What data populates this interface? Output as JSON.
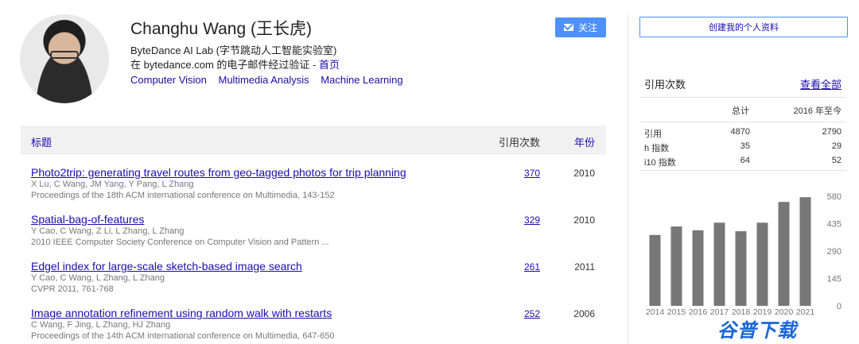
{
  "profile": {
    "name": "Changhu Wang (王长虎)",
    "affiliation": "ByteDance AI Lab (字节跳动人工智能实验室)",
    "email_prefix": "在 bytedance.com 的电子邮件经过验证 - ",
    "email_home": "首页",
    "interests": [
      "Computer Vision",
      "Multimedia Analysis",
      "Machine Learning"
    ]
  },
  "buttons": {
    "follow": "关注",
    "create_profile": "创建我的个人资料"
  },
  "table": {
    "header_title": "标题",
    "header_cites": "引用次数",
    "header_year": "年份",
    "rows": [
      {
        "title": "Photo2trip: generating travel routes from geo-tagged photos for trip planning",
        "authors": "X Lu, C Wang, JM Yang, Y Pang, L Zhang",
        "venue": "Proceedings of the 18th ACM international conference on Multimedia, 143-152",
        "cites": "370",
        "year": "2010"
      },
      {
        "title": "Spatial-bag-of-features",
        "authors": "Y Cao, C Wang, Z Li, L Zhang, L Zhang",
        "venue": "2010 IEEE Computer Society Conference on Computer Vision and Pattern ...",
        "cites": "329",
        "year": "2010"
      },
      {
        "title": "Edgel index for large-scale sketch-based image search",
        "authors": "Y Cao, C Wang, L Zhang, L Zhang",
        "venue": "CVPR 2011, 761-768",
        "cites": "261",
        "year": "2011"
      },
      {
        "title": "Image annotation refinement using random walk with restarts",
        "authors": "C Wang, F Jing, L Zhang, HJ Zhang",
        "venue": "Proceedings of the 14th ACM international conference on Multimedia, 647-650",
        "cites": "252",
        "year": "2006"
      }
    ]
  },
  "citations": {
    "heading": "引用次数",
    "view_all": "查看全部",
    "col_total": "总计",
    "col_since": "2016 年至今",
    "stats": [
      {
        "label": "引用",
        "total": "4870",
        "since": "2790"
      },
      {
        "label": "h 指数",
        "total": "35",
        "since": "29"
      },
      {
        "label": "i10 指数",
        "total": "64",
        "since": "52"
      }
    ]
  },
  "chart_data": {
    "type": "bar",
    "categories": [
      "2014",
      "2015",
      "2016",
      "2017",
      "2018",
      "2019",
      "2020",
      "2021"
    ],
    "values": [
      375,
      420,
      400,
      440,
      395,
      440,
      550,
      575
    ],
    "yticks": [
      0,
      145,
      290,
      435,
      580
    ],
    "ylim": [
      0,
      580
    ],
    "bar_color": "#777777"
  },
  "watermark": "谷普下载",
  "colors": {
    "link": "#1a0dab",
    "button": "#4d90fe"
  }
}
